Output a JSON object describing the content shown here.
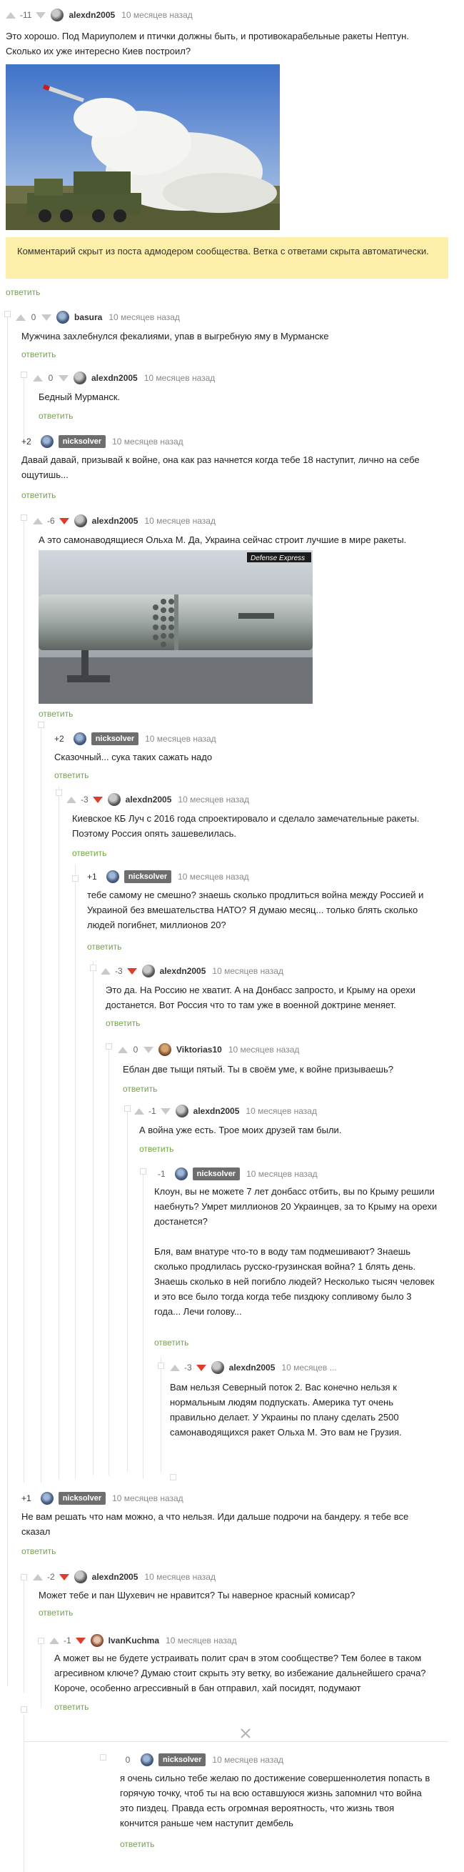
{
  "reply_label": "ответить",
  "notice": "Комментарий скрыт из поста адмодером сообщества. Ветка с ответами скрыта автоматически.",
  "comments": [
    {
      "score": "-11",
      "user": "alexdn2005",
      "time": "10 месяцев назад",
      "lines": [
        "Это хорошо. Под Мариуполем и птички должны быть, и противокарабельные ракеты Нептун.",
        "Сколько их уже интересно Киев построил?"
      ]
    },
    {
      "score": "0",
      "user": "basura",
      "time": "10 месяцев назад",
      "lines": [
        "Мужчина захлебнулся фекалиями, упав в выгребную яму в Мурманске"
      ]
    },
    {
      "score": "0",
      "user": "alexdn2005",
      "time": "10 месяцев назад",
      "lines": [
        "Бедный Мурманск."
      ]
    },
    {
      "score": "+2",
      "user": "nicksolver",
      "time": "10 месяцев назад",
      "lines": [
        "Давай давай, призывай к войне, она как раз начнется когда тебе 18 наступит, лично на себе",
        "ощутишь..."
      ]
    },
    {
      "score": "-6",
      "user": "alexdn2005",
      "time": "10 месяцев назад",
      "lines": [
        "А это самонаводящиеся Ольха М. Да, Украина сейчас строит лучшие в мире ракеты."
      ]
    },
    {
      "score": "+2",
      "user": "nicksolver",
      "time": "10 месяцев назад",
      "lines": [
        "Сказочный... сука таких сажать надо"
      ]
    },
    {
      "score": "-3",
      "user": "alexdn2005",
      "time": "10 месяцев назад",
      "lines": [
        "Киевское КБ Луч с 2016 года спроектировало и сделало замечательные ракеты.",
        "Поэтому Россия опять зашевелилась."
      ]
    },
    {
      "score": "+1",
      "user": "nicksolver",
      "time": "10 месяцев назад",
      "lines": [
        "тебе самому не смешно? знаешь сколько продлиться война между Россией и",
        "Украиной без вмешательства НАТО? Я думаю месяц...  только блять сколько",
        "людей погибнет, миллионов 20?"
      ]
    },
    {
      "score": "-3",
      "user": "alexdn2005",
      "time": "10 месяцев назад",
      "lines": [
        "Это да. На Россию не хватит. А на Донбасс запросто, и Крыму на орехи",
        "достанется. Вот Россия что то там уже в военной доктрине меняет."
      ]
    },
    {
      "score": "0",
      "user": "Viktorias10",
      "time": "10 месяцев назад",
      "lines": [
        "Еблан две тыщи пятый. Ты в своём уме, к войне призываешь?"
      ]
    },
    {
      "score": "-1",
      "user": "alexdn2005",
      "time": "10 месяцев назад",
      "lines": [
        "А война уже есть. Трое моих друзей там были."
      ]
    },
    {
      "score": "-1",
      "user": "nicksolver",
      "time": "10 месяцев назад",
      "lines": [
        "Клоун, вы не можете 7 лет донбасс отбить, вы по Крыму решили",
        "наебнуть? Умрет миллионов 20 Украинцев, за то Крыму на орехи",
        "достанется?",
        "",
        "Бля, вам внатуре что-то в воду там подмешивают? Знаешь",
        "сколько продлилась русско-грузинская война? 1 блять день.",
        "Знаешь сколько в ней погибло людей? Несколько тысяч человек",
        "и это все было тогда когда тебе пиздюку сопливому было 3",
        "года... Лечи голову..."
      ]
    },
    {
      "score": "-3",
      "user": "alexdn2005",
      "time": "10 месяцев ...",
      "lines": [
        "Вам нельзя Северный поток 2. Вас конечно нельзя к",
        "нормальным людям подпускать. Америка тут очень",
        "правильно делает. У Украины по плану сделать 2500",
        "самонаводящихся ракет Ольха М. Это вам не Грузия."
      ]
    },
    {
      "score": "+1",
      "user": "nicksolver",
      "time": "10 месяцев назад",
      "lines": [
        "Не вам решать что нам можно, а что нельзя. Иди дальше подрочи на бандеру. я тебе все",
        "сказал"
      ]
    },
    {
      "score": "-2",
      "user": "alexdn2005",
      "time": "10 месяцев назад",
      "lines": [
        "Может тебе и пан Шухевич не нравится? Ты наверное красный комисар?"
      ]
    },
    {
      "score": "-1",
      "user": "IvanKuchma",
      "time": "10 месяцев назад",
      "lines": [
        "А может вы не будете устраивать полит срач в этом сообществе? Тем более в таком",
        "агресивном ключе? Думаю стоит скрыть эту ветку, во избежание дальнейшего срача?",
        "Короче, особенно агрессивный в бан отправил, хай посидят, подумают"
      ]
    },
    {
      "score": "0",
      "user": "nicksolver",
      "time": "10 месяцев назад",
      "lines": [
        "я очень сильно тебе желаю по достижение совершеннолетия попасть в",
        "горячую точку, чтоб ты на всю оставшуюся жизнь запомнил что война",
        "это пиздец. Правда есть огромная вероятность, что жизнь твоя",
        "кончится раньше чем наступит дембель"
      ]
    }
  ],
  "photo2_caption": "Defense Express",
  "colors": {
    "link": "#6fa640",
    "downvote_active": "#e03c2c",
    "notice_bg": "#fdeeaa",
    "badge_bg": "#6e6e6e"
  }
}
